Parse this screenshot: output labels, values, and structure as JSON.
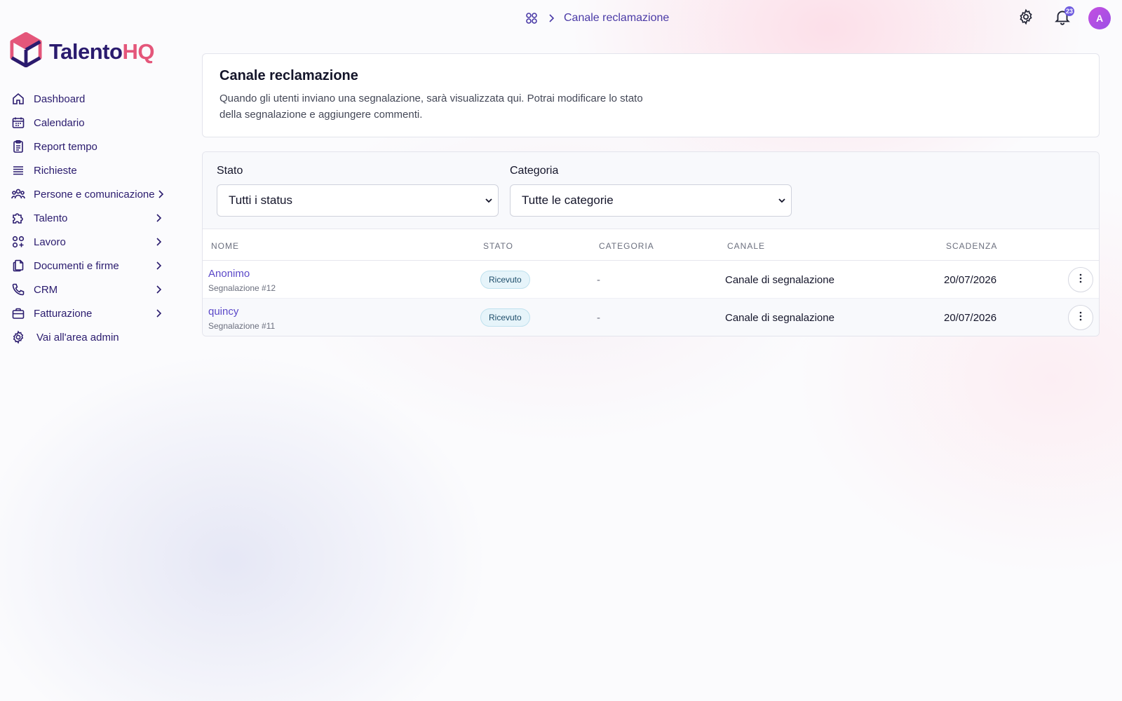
{
  "breadcrumb": {
    "icon": "apps-grid-icon",
    "current": "Canale reclamazione"
  },
  "topbar": {
    "notifications_count": "23",
    "avatar_initial": "A"
  },
  "brand": {
    "part1": "Talento",
    "part2": "HQ"
  },
  "sidebar": {
    "items": [
      {
        "label": "Dashboard",
        "icon": "home-icon",
        "has_submenu": false
      },
      {
        "label": "Calendario",
        "icon": "calendar-icon",
        "has_submenu": false
      },
      {
        "label": "Report tempo",
        "icon": "clipboard-icon",
        "has_submenu": false
      },
      {
        "label": "Richieste",
        "icon": "list-icon",
        "has_submenu": false
      },
      {
        "label": "Persone e comunicazione",
        "icon": "users-icon",
        "has_submenu": true
      },
      {
        "label": "Talento",
        "icon": "puzzle-icon",
        "has_submenu": true
      },
      {
        "label": "Lavoro",
        "icon": "grid-plus-icon",
        "has_submenu": true
      },
      {
        "label": "Documenti e firme",
        "icon": "documents-icon",
        "has_submenu": true
      },
      {
        "label": "CRM",
        "icon": "phone-icon",
        "has_submenu": true
      },
      {
        "label": "Fatturazione",
        "icon": "briefcase-icon",
        "has_submenu": true
      },
      {
        "label": "Vai all'area admin",
        "icon": "gear-icon",
        "has_submenu": false
      }
    ]
  },
  "header": {
    "title": "Canale reclamazione",
    "description": "Quando gli utenti inviano una segnalazione, sarà visualizzata qui. Potrai modificare lo stato della segnalazione e aggiungere commenti."
  },
  "filters": {
    "status": {
      "label": "Stato",
      "selected": "Tutti i status"
    },
    "category": {
      "label": "Categoria",
      "selected": "Tutte le categorie"
    }
  },
  "table": {
    "columns": [
      "Nome",
      "Stato",
      "Categoria",
      "Canale",
      "Scadenza"
    ],
    "rows": [
      {
        "name": "Anonimo",
        "subtitle": "Segnalazione #12",
        "status": "Ricevuto",
        "category": "-",
        "channel": "Canale di segnalazione",
        "deadline": "20/07/2026"
      },
      {
        "name": "quincy",
        "subtitle": "Segnalazione #11",
        "status": "Ricevuto",
        "category": "-",
        "channel": "Canale di segnalazione",
        "deadline": "20/07/2026"
      }
    ]
  },
  "colors": {
    "brand_dark": "#2a1b6e",
    "brand_pink": "#e4567a",
    "accent": "#5b48c8",
    "badge_bg": "#e6f4fa"
  }
}
